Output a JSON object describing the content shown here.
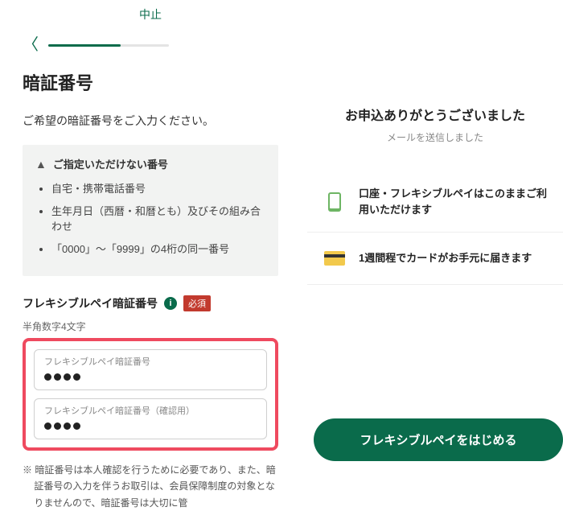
{
  "topbar": {
    "cancel": "中止"
  },
  "page": {
    "title": "暗証番号",
    "instruction": "ご希望の暗証番号をご入力ください。"
  },
  "warning": {
    "header": "ご指定いただけない番号",
    "items": [
      "自宅・携帯電話番号",
      "生年月日（西暦・和暦とも）及びその組み合わせ",
      "「0000」～「9999」の4桁の同一番号"
    ]
  },
  "pin_section": {
    "label": "フレキシブルペイ暗証番号",
    "required": "必須",
    "hint": "半角数字4文字",
    "field1_label": "フレキシブルペイ暗証番号",
    "field2_label": "フレキシブルペイ暗証番号（確認用）"
  },
  "footnote": "※ 暗証番号は本人確認を行うために必要であり、また、暗証番号の入力を伴うお取引は、会員保障制度の対象となりませんので、暗証番号は大切に管",
  "thanks": {
    "title": "お申込ありがとうございました",
    "sub": "メールを送信しました"
  },
  "status": {
    "row1": "口座・フレキシブルペイはこのままご利用いただけます",
    "row2": "1週間程でカードがお手元に届きます"
  },
  "cta": {
    "label": "フレキシブルペイをはじめる"
  }
}
